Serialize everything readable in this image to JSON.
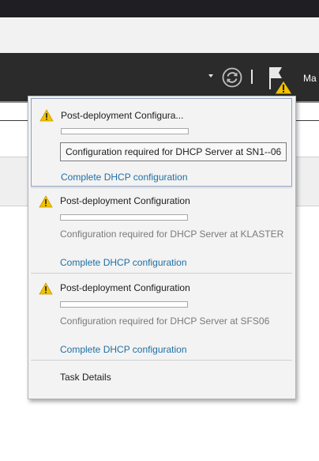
{
  "header": {
    "menu_label": "Ma"
  },
  "notifications": [
    {
      "title": "Post-deployment Configura...",
      "progress": 0,
      "tooltip": "Configuration required for DHCP Server at SN1--06",
      "link": "Complete DHCP configuration"
    },
    {
      "title": "Post-deployment Configuration",
      "progress": 0,
      "description": "Configuration required for DHCP Server at KLASTER",
      "link": "Complete DHCP configuration"
    },
    {
      "title": "Post-deployment Configuration",
      "progress": 0,
      "description": "Configuration required for DHCP Server at SFS06",
      "link": "Complete DHCP configuration"
    }
  ],
  "footer": {
    "task_details": "Task Details"
  },
  "icons": {
    "warning": "warning-icon",
    "refresh": "refresh-icon",
    "flag": "notifications-flag-icon"
  },
  "colors": {
    "link": "#1f6fa5",
    "warning": "#f2c200",
    "header_bg": "#2b2b2b"
  }
}
